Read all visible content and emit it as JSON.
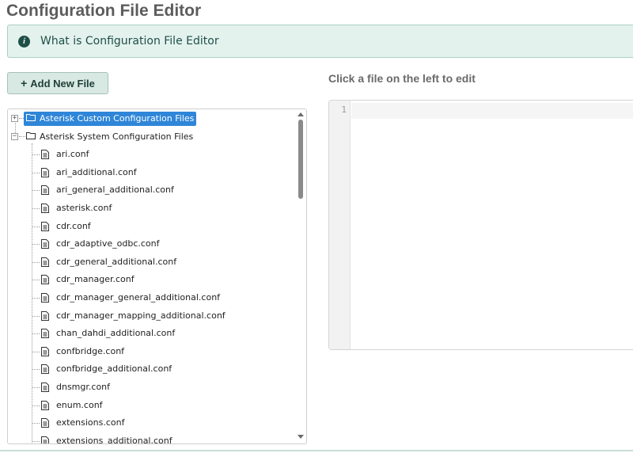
{
  "page": {
    "title": "Configuration File Editor"
  },
  "info": {
    "icon": "info-circle-icon",
    "text": "What is Configuration File Editor"
  },
  "toolbar": {
    "add_icon": "plus-icon",
    "add_label": "Add New File"
  },
  "editor": {
    "heading": "Click a file on the left to edit",
    "line_numbers": [
      "1"
    ]
  },
  "tree": {
    "folders": [
      {
        "label": "Asterisk Custom Configuration Files",
        "expanded": false,
        "selected": true,
        "icon": "folder-icon"
      },
      {
        "label": "Asterisk System Configuration Files",
        "expanded": true,
        "selected": false,
        "icon": "folder-icon"
      }
    ],
    "files": [
      "ari.conf",
      "ari_additional.conf",
      "ari_general_additional.conf",
      "asterisk.conf",
      "cdr.conf",
      "cdr_adaptive_odbc.conf",
      "cdr_general_additional.conf",
      "cdr_manager.conf",
      "cdr_manager_general_additional.conf",
      "cdr_manager_mapping_additional.conf",
      "chan_dahdi_additional.conf",
      "confbridge.conf",
      "confbridge_additional.conf",
      "dnsmgr.conf",
      "enum.conf",
      "extensions.conf",
      "extensions_additional.conf"
    ],
    "file_icon": "file-text-icon"
  },
  "colors": {
    "selected_bg": "#2f86d8",
    "info_bg": "#e4f2ee",
    "info_border": "#a9cfc5",
    "button_bg": "#d8e8e2"
  }
}
